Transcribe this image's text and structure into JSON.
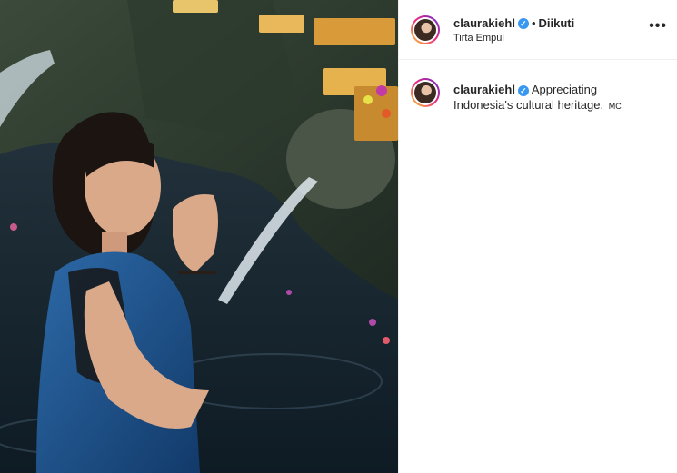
{
  "post": {
    "author": {
      "username": "claurakiehl",
      "verified_icon": "verified-badge-icon",
      "separator": "•",
      "follow_status": "Diikuti",
      "location": "Tirta Empul"
    },
    "more_options": "•••",
    "caption": {
      "username": "claurakiehl",
      "text": "Appreciating Indonesia's cultural heritage.",
      "suffix": "MC"
    },
    "image": {
      "description_icon": "post-photo"
    }
  },
  "colors": {
    "verified": "#3897f0",
    "text": "#262626",
    "border": "#efefef"
  }
}
